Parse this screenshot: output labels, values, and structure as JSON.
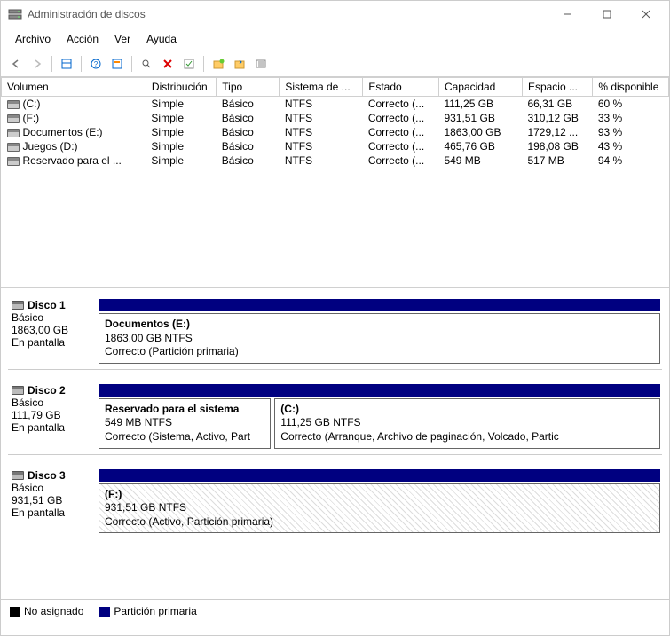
{
  "window": {
    "title": "Administración de discos"
  },
  "menu": {
    "archivo": "Archivo",
    "accion": "Acción",
    "ver": "Ver",
    "ayuda": "Ayuda"
  },
  "columns": {
    "volumen": "Volumen",
    "distribucion": "Distribución",
    "tipo": "Tipo",
    "sistema": "Sistema de ...",
    "estado": "Estado",
    "capacidad": "Capacidad",
    "espacio": "Espacio ...",
    "disponible": "% disponible"
  },
  "volumes": [
    {
      "name": "(C:)",
      "layout": "Simple",
      "type": "Básico",
      "fs": "NTFS",
      "status": "Correcto (...",
      "capacity": "111,25 GB",
      "free": "66,31 GB",
      "pct": "60 %"
    },
    {
      "name": "(F:)",
      "layout": "Simple",
      "type": "Básico",
      "fs": "NTFS",
      "status": "Correcto (...",
      "capacity": "931,51 GB",
      "free": "310,12 GB",
      "pct": "33 %"
    },
    {
      "name": "Documentos (E:)",
      "layout": "Simple",
      "type": "Básico",
      "fs": "NTFS",
      "status": "Correcto (...",
      "capacity": "1863,00 GB",
      "free": "1729,12 ...",
      "pct": "93 %"
    },
    {
      "name": "Juegos (D:)",
      "layout": "Simple",
      "type": "Básico",
      "fs": "NTFS",
      "status": "Correcto (...",
      "capacity": "465,76 GB",
      "free": "198,08 GB",
      "pct": "43 %"
    },
    {
      "name": "Reservado para el ...",
      "layout": "Simple",
      "type": "Básico",
      "fs": "NTFS",
      "status": "Correcto (...",
      "capacity": "549 MB",
      "free": "517 MB",
      "pct": "94 %"
    }
  ],
  "disks": [
    {
      "name": "Disco 1",
      "type": "Básico",
      "size": "1863,00 GB",
      "status": "En pantalla",
      "parts": [
        {
          "title": "Documentos  (E:)",
          "line2": "1863,00 GB NTFS",
          "line3": "Correcto (Partición primaria)",
          "grow": 10,
          "hatched": false
        }
      ]
    },
    {
      "name": "Disco 2",
      "type": "Básico",
      "size": "111,79 GB",
      "status": "En pantalla",
      "parts": [
        {
          "title": "Reservado para el sistema",
          "line2": "549 MB NTFS",
          "line3": "Correcto (Sistema, Activo, Part",
          "grow": 3,
          "hatched": false
        },
        {
          "title": "(C:)",
          "line2": "111,25 GB NTFS",
          "line3": "Correcto (Arranque, Archivo de paginación, Volcado, Partic",
          "grow": 7,
          "hatched": false
        }
      ]
    },
    {
      "name": "Disco 3",
      "type": "Básico",
      "size": "931,51 GB",
      "status": "En pantalla",
      "parts": [
        {
          "title": "(F:)",
          "line2": "931,51 GB NTFS",
          "line3": "Correcto (Activo, Partición primaria)",
          "grow": 10,
          "hatched": true
        }
      ]
    }
  ],
  "legend": {
    "unallocated": "No asignado",
    "primary": "Partición primaria"
  }
}
